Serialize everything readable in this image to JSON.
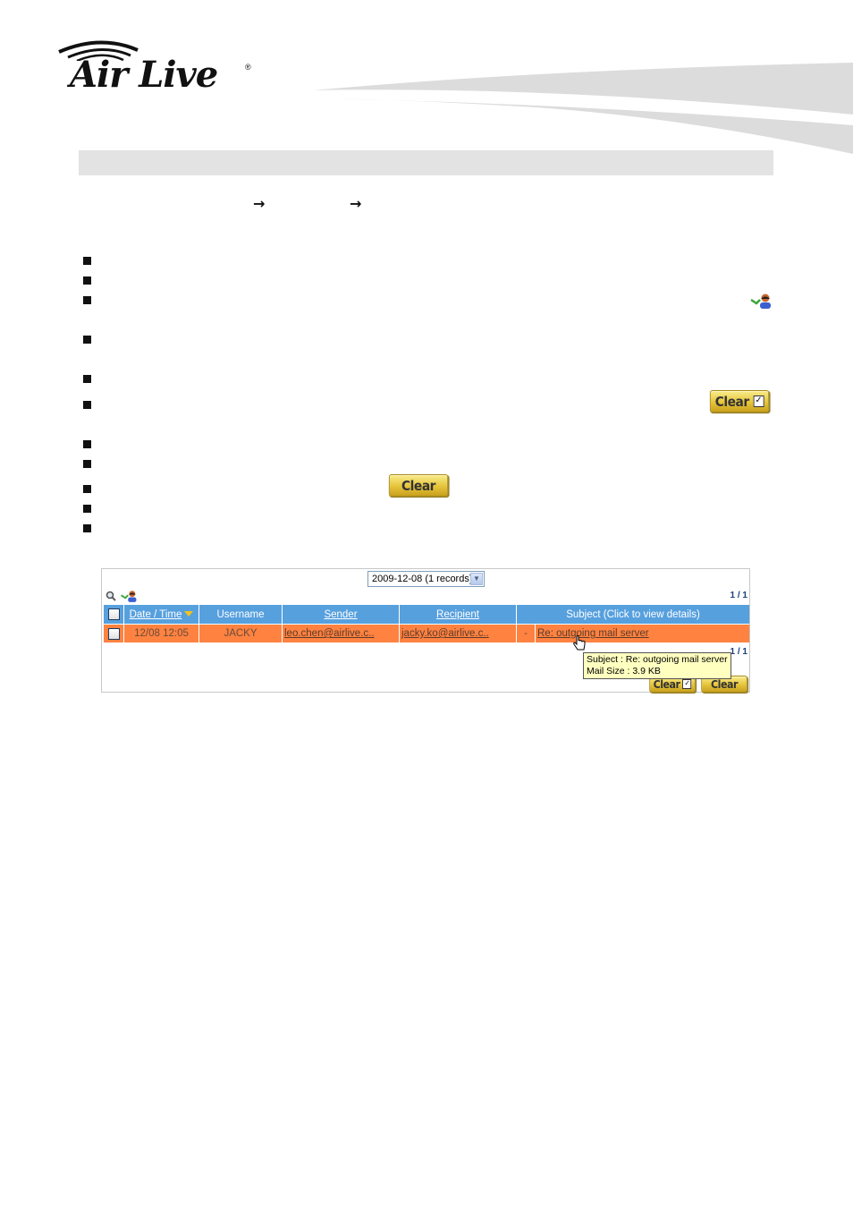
{
  "header": {
    "logo_text": "Air Live",
    "logo_mark": "®"
  },
  "nav_arrows": [
    "→",
    "→"
  ],
  "inline_buttons": {
    "clear_checked_label": "Clear",
    "clear_label": "Clear"
  },
  "panel": {
    "date_select": {
      "selected": "2009-12-08 (1 records)"
    },
    "pager_top": "1 / 1",
    "pager_bottom": "1 / 1",
    "columns": [
      {
        "label": "Date / Time",
        "sortable": true,
        "sorted": true
      },
      {
        "label": "Username",
        "sortable": false
      },
      {
        "label": "Sender",
        "sortable": true
      },
      {
        "label": "Recipient",
        "sortable": true
      },
      {
        "label": "Subject (Click to view details)",
        "sortable": false
      }
    ],
    "rows": [
      {
        "datetime": "12/08 12:05",
        "username": "JACKY",
        "sender": "leo.chen@airlive.c..",
        "recipient": "jacky.ko@airlive.c..",
        "flag": "-",
        "subject": "Re: outgoing mail server"
      }
    ],
    "tooltip": {
      "line1": "Subject : Re: outgoing mail server",
      "line2": "Mail Size : 3.9 KB"
    },
    "buttons": {
      "clear_checked": "Clear",
      "clear_all": "Clear"
    }
  },
  "colors": {
    "header_blue": "#57a0de",
    "row_orange": "#ff8240",
    "section_gray": "#e3e3e3",
    "tooltip_yellow": "#ffffc0"
  }
}
